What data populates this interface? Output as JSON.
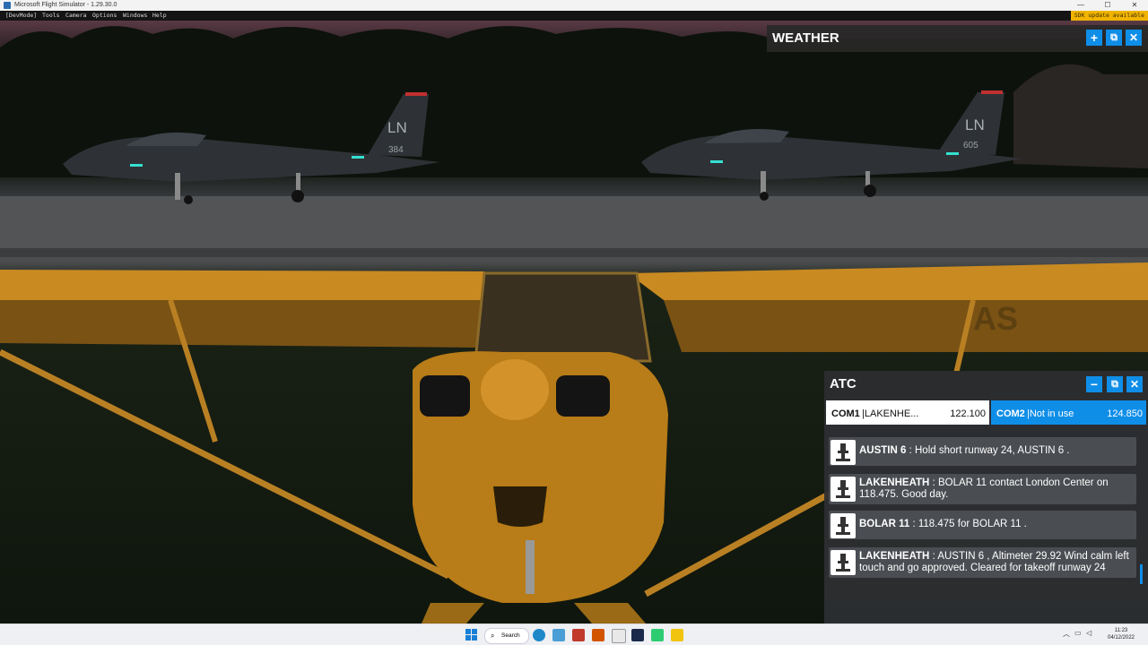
{
  "window": {
    "title": "Microsoft Flight Simulator - 1.29.30.0",
    "controls": [
      "—",
      "☐",
      "✕"
    ]
  },
  "devmode_bar": {
    "items": [
      "[DevMode]",
      "Tools",
      "Camera",
      "Options",
      "Windows",
      "Help"
    ],
    "sdk_notice": "SDK update available"
  },
  "scene": {
    "jet_left_tail": "LN",
    "jet_left_number": "384",
    "jet_right_tail": "LN",
    "jet_right_number": "605",
    "wing_text": "AS"
  },
  "weather_panel": {
    "title": "WEATHER"
  },
  "atc_panel": {
    "title": "ATC",
    "com1": {
      "label": "COM1",
      "station": "LAKENHE...",
      "freq": "122.100"
    },
    "com2": {
      "label": "COM2",
      "station": "Not in use",
      "freq": "124.850"
    },
    "messages": [
      {
        "speaker": "AUSTIN 6",
        "text": " : Hold short runway 24, AUSTIN 6 ."
      },
      {
        "speaker": "LAKENHEATH",
        "text": " : BOLAR 11 contact London Center on 118.475. Good day."
      },
      {
        "speaker": "BOLAR 11",
        "text": " : 118.475 for BOLAR 11 ."
      },
      {
        "speaker": "LAKENHEATH",
        "text": " : AUSTIN 6 , Altimeter 29.92 Wind calm left touch and go approved. Cleared for takeoff runway 24"
      }
    ]
  },
  "taskbar": {
    "search_label": "Search",
    "time": "11:23",
    "date": "04/12/2022"
  },
  "colors": {
    "accent": "#0f8ee8",
    "sdk_bg": "#f0b400",
    "panel_bg": "#2b2c2e",
    "message_bg": "#4a4d52"
  }
}
